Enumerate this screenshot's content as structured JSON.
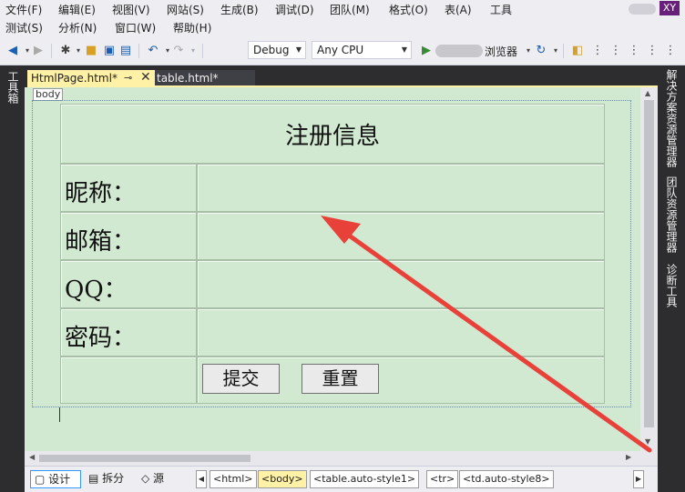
{
  "menu_row1": [
    "文件(F)",
    "编辑(E)",
    "视图(V)",
    "网站(S)",
    "生成(B)",
    "调试(D)",
    "团队(M)",
    "格式(O)",
    "表(A)",
    "工具"
  ],
  "menu_row2": [
    "测试(S)",
    "分析(N)",
    "窗口(W)",
    "帮助(H)"
  ],
  "user_badge": "XY",
  "toolbar": {
    "config_combo": "Debug",
    "platform_combo": "Any CPU",
    "browser_label": "浏览器"
  },
  "left_strip_label": "工具箱",
  "right_strip_labels": [
    "解决方案资源管理器",
    "团队资源管理器",
    "诊断工具"
  ],
  "tabs": [
    {
      "label": "HtmlPage.html*",
      "active": true
    },
    {
      "label": "table.html*",
      "active": false
    }
  ],
  "design": {
    "body_tag": "body",
    "form": {
      "title": "注册信息",
      "rows": [
        "昵称：",
        "邮箱：",
        "QQ：",
        "密码："
      ],
      "submit_label": "提交",
      "reset_label": "重置"
    }
  },
  "bottom": {
    "views": [
      "设计",
      "拆分",
      "源"
    ],
    "breadcrumbs": [
      "<html>",
      "<body>",
      "<table.auto-style1>",
      "<tr>",
      "<td.auto-style8>"
    ],
    "selected_breadcrumb": "<body>"
  },
  "colors": {
    "design_bg": "#d1e8d1",
    "active_tab": "#fff1a6",
    "annotation_arrow": "#e8413a"
  }
}
